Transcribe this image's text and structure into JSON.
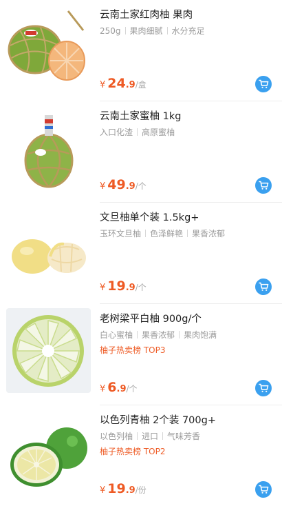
{
  "accent_color": "#ee5a24",
  "cart_color": "#3aa0ef",
  "products": [
    {
      "title": "云南土家红肉柚 果肉",
      "tags": [
        "250g",
        "果肉细腻",
        "水分充足"
      ],
      "rank": "",
      "currency": "¥",
      "price_int": "24",
      "price_dec": ".9",
      "unit": "/盒",
      "image": "red-pomelo-netted-icon",
      "cart_icon": "cart-icon"
    },
    {
      "title": "云南土家蜜柚 1kg",
      "tags": [
        "入口化渣",
        "高原蜜柚"
      ],
      "rank": "",
      "currency": "¥",
      "price_int": "49",
      "price_dec": ".9",
      "unit": "/个",
      "image": "honey-pomelo-netted-icon",
      "cart_icon": "cart-icon"
    },
    {
      "title": "文旦柚单个装 1.5kg+",
      "tags": [
        "玉环文旦柚",
        "色泽鲜艳",
        "果香浓郁"
      ],
      "rank": "",
      "currency": "¥",
      "price_int": "19",
      "price_dec": ".9",
      "unit": "/个",
      "image": "wendan-pomelo-icon",
      "cart_icon": "cart-icon"
    },
    {
      "title": "老树梁平白柚 900g/个",
      "tags": [
        "白心蜜柚",
        "果香浓郁",
        "果肉饱满"
      ],
      "rank": "柚子热卖榜 TOP3",
      "currency": "¥",
      "price_int": "6",
      "price_dec": ".9",
      "unit": "/个",
      "image": "white-pomelo-sliced-icon",
      "cart_icon": "cart-icon"
    },
    {
      "title": "以色列青柚 2个装 700g+",
      "tags": [
        "以色列柚",
        "进口",
        "气味芳香"
      ],
      "rank": "柚子热卖榜 TOP2",
      "currency": "¥",
      "price_int": "19",
      "price_dec": ".9",
      "unit": "/份",
      "image": "green-pomelo-icon",
      "cart_icon": "cart-icon"
    }
  ]
}
